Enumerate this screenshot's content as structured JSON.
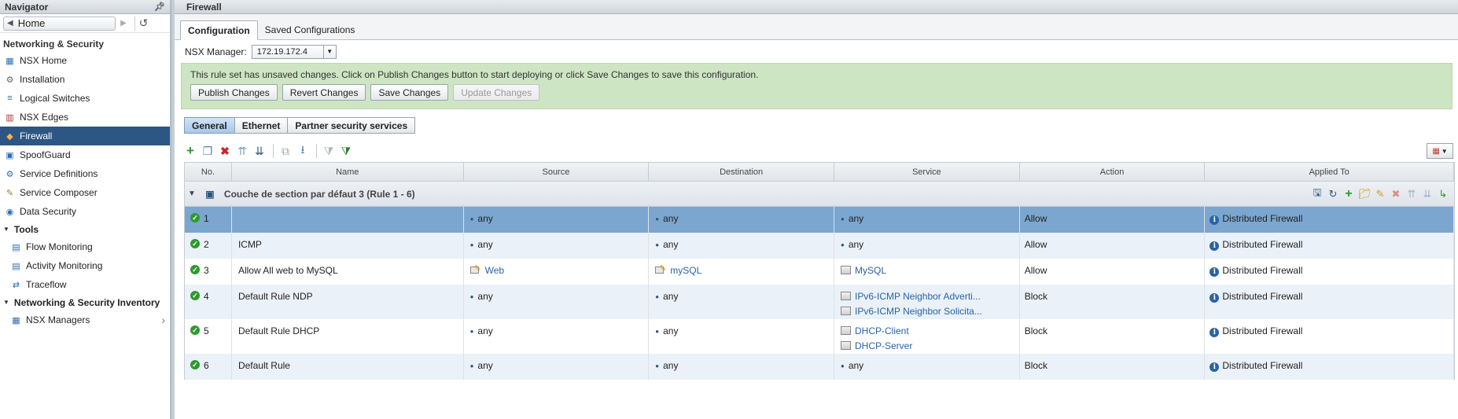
{
  "navigator": {
    "title": "Navigator",
    "home": "Home",
    "section_title": "Networking & Security",
    "items": [
      {
        "label": "NSX Home",
        "icon": "nsx-home-icon"
      },
      {
        "label": "Installation",
        "icon": "gear-icon"
      },
      {
        "label": "Logical Switches",
        "icon": "switch-icon"
      },
      {
        "label": "NSX Edges",
        "icon": "edge-icon"
      },
      {
        "label": "Firewall",
        "icon": "firewall-icon",
        "selected": true
      },
      {
        "label": "SpoofGuard",
        "icon": "spoofguard-icon"
      },
      {
        "label": "Service Definitions",
        "icon": "service-definitions-icon"
      },
      {
        "label": "Service Composer",
        "icon": "service-composer-icon"
      },
      {
        "label": "Data Security",
        "icon": "data-security-icon"
      }
    ],
    "tools_label": "Tools",
    "tools": [
      {
        "label": "Flow Monitoring",
        "icon": "flow-monitoring-icon"
      },
      {
        "label": "Activity Monitoring",
        "icon": "activity-monitoring-icon"
      },
      {
        "label": "Traceflow",
        "icon": "traceflow-icon"
      }
    ],
    "inventory_label": "Networking & Security Inventory",
    "inventory": [
      {
        "label": "NSX Managers",
        "icon": "nsx-managers-icon"
      }
    ]
  },
  "main": {
    "title": "Firewall",
    "tabs": [
      "Configuration",
      "Saved Configurations"
    ],
    "manager_label": "NSX Manager:",
    "manager_value": "172.19.172.4",
    "banner_message": "This rule set has unsaved changes. Click on Publish Changes button to start deploying or click Save Changes to save this configuration.",
    "banner_buttons": {
      "publish": "Publish Changes",
      "revert": "Revert Changes",
      "save": "Save Changes",
      "update": "Update Changes"
    },
    "subtabs": [
      "General",
      "Ethernet",
      "Partner security services"
    ],
    "columns": [
      "No.",
      "Name",
      "Source",
      "Destination",
      "Service",
      "Action",
      "Applied To"
    ],
    "section_title": "Couche de section par défaut 3 (Rule 1 - 6)",
    "rules": [
      {
        "no": "1",
        "name": "",
        "source": "any",
        "destination": "any",
        "services": [
          "any"
        ],
        "action": "Allow",
        "applied_to": "Distributed Firewall"
      },
      {
        "no": "2",
        "name": "ICMP",
        "source": "any",
        "destination": "any",
        "services": [
          "any"
        ],
        "action": "Allow",
        "applied_to": "Distributed Firewall"
      },
      {
        "no": "3",
        "name": "Allow All web to MySQL",
        "source": "Web",
        "destination": "mySQL",
        "services": [
          "MySQL"
        ],
        "action": "Allow",
        "applied_to": "Distributed Firewall"
      },
      {
        "no": "4",
        "name": "Default Rule NDP",
        "source": "any",
        "destination": "any",
        "services": [
          "IPv6-ICMP Neighbor Adverti...",
          "IPv6-ICMP Neighbor Solicita..."
        ],
        "action": "Block",
        "applied_to": "Distributed Firewall"
      },
      {
        "no": "5",
        "name": "Default Rule DHCP",
        "source": "any",
        "destination": "any",
        "services": [
          "DHCP-Client",
          "DHCP-Server"
        ],
        "action": "Block",
        "applied_to": "Distributed Firewall"
      },
      {
        "no": "6",
        "name": "Default Rule",
        "source": "any",
        "destination": "any",
        "services": [
          "any"
        ],
        "action": "Block",
        "applied_to": "Distributed Firewall"
      }
    ]
  },
  "colors": {
    "selected_nav": "#2c5683",
    "banner": "#cde5c2",
    "selected_row": "#7ba6cf",
    "alt_row": "#eaf1f8",
    "link": "#2a63a8",
    "ok": "#2e9a2e"
  }
}
